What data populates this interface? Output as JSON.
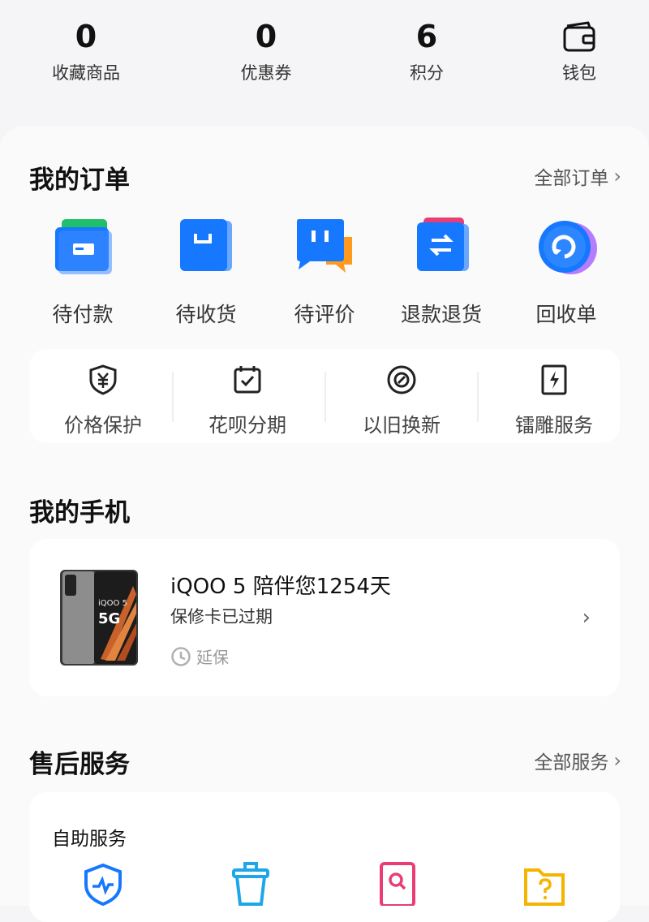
{
  "stats": [
    {
      "value": "0",
      "label": "收藏商品"
    },
    {
      "value": "0",
      "label": "优惠券"
    },
    {
      "value": "6",
      "label": "积分"
    },
    {
      "icon": "wallet-icon",
      "label": "钱包"
    }
  ],
  "orders_section": {
    "title": "我的订单",
    "more": "全部订单",
    "items": [
      {
        "label": "待付款",
        "icon": "pending-payment-icon",
        "color": "#1677ff"
      },
      {
        "label": "待收货",
        "icon": "pending-delivery-icon",
        "color": "#1677ff"
      },
      {
        "label": "待评价",
        "icon": "pending-review-icon",
        "color": "#1677ff"
      },
      {
        "label": "退款退货",
        "icon": "refund-icon",
        "color": "#1677ff"
      },
      {
        "label": "回收单",
        "icon": "recycle-order-icon",
        "color": "#1677ff"
      }
    ]
  },
  "tools": [
    {
      "label": "价格保护",
      "icon": "price-protect-icon"
    },
    {
      "label": "花呗分期",
      "icon": "calendar-check-icon"
    },
    {
      "label": "以旧换新",
      "icon": "trade-in-icon"
    },
    {
      "label": "镭雕服务",
      "icon": "laser-engrave-icon"
    }
  ],
  "phone_section": {
    "title": "我的手机",
    "device": {
      "title": "iQOO 5 陪伴您1254天",
      "warranty": "保修卡已过期",
      "extend": "延保"
    }
  },
  "service_section": {
    "title": "售后服务",
    "more": "全部服务",
    "self_service_title": "自助服务",
    "icons": [
      "diagnosis-icon",
      "clean-icon",
      "search-doc-icon",
      "help-folder-icon"
    ]
  },
  "colors": {
    "accent": "#1677ff",
    "orange": "#ff9a1f",
    "pink": "#e83e74",
    "yellow": "#f5b400",
    "cyan": "#1ea7e8"
  }
}
